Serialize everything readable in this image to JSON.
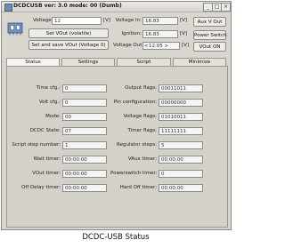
{
  "window": {
    "title": "DCDCUSB ver: 3.0 mode: 00 (Dumb)",
    "minimize_glyph": "_",
    "maximize_glyph": "□",
    "close_glyph": "×"
  },
  "top": {
    "voltage_label": "Voltage:",
    "voltage_value": "12",
    "voltage_unit": "[V]",
    "set_vout_label": "Set VOut (volatile)",
    "set_save_label": "Set and save VOut (Voltage 0)",
    "vin_label": "Voltage In:",
    "vin_value": "16.83",
    "vin_unit": "[V]",
    "ignition_label": "Ignition:",
    "ignition_value": "16.83",
    "ignition_unit": "[V]",
    "vout_label": "Voltage Out:",
    "vout_value": "12.05",
    "vout_unit": "[V]",
    "aux_label": "Aux V Out",
    "power_switch_label": "Power Switch",
    "vout_on_label": "VOut ON"
  },
  "tabs": [
    {
      "label": "Status"
    },
    {
      "label": "Settings"
    },
    {
      "label": "Script"
    },
    {
      "label": "Minimize"
    }
  ],
  "status_left": [
    {
      "label": "Time cfg.:",
      "value": "0"
    },
    {
      "label": "Volt cfg.:",
      "value": "0"
    },
    {
      "label": "Mode:",
      "value": "00"
    },
    {
      "label": "DCDC State:",
      "value": "07"
    },
    {
      "label": "Script step number:",
      "value": "1"
    },
    {
      "label": "Wait timer:",
      "value": "00:00:00"
    },
    {
      "label": "VOut timer:",
      "value": "00:00:00"
    },
    {
      "label": "Off Delay timer:",
      "value": "00:00:00"
    }
  ],
  "status_right": [
    {
      "label": "Output flags:",
      "value": "00011011"
    },
    {
      "label": "Pin configuration:",
      "value": "00000000"
    },
    {
      "label": "Voltage flags:",
      "value": "01010011"
    },
    {
      "label": "Timer flags:",
      "value": "11111111"
    },
    {
      "label": "Regulator steps:",
      "value": "5"
    },
    {
      "label": "VAux timer:",
      "value": "00:00:00"
    },
    {
      "label": "Powerswitch timer:",
      "value": "0"
    },
    {
      "label": "Hard Off timer:",
      "value": "00:00:00"
    }
  ],
  "caption": "DCDC-USB Status",
  "icons": [
    "app-icon",
    "chip-icon",
    "spin-down-icon",
    "spin-up-icon"
  ]
}
